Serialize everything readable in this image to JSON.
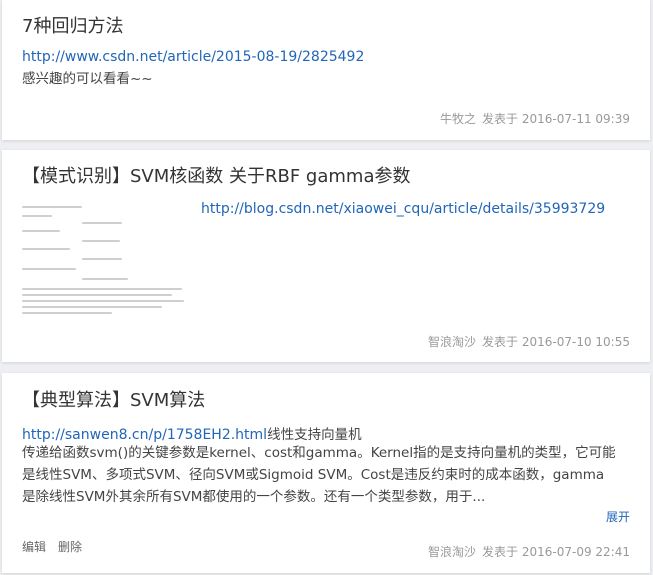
{
  "posts": [
    {
      "title": "7种回归方法",
      "link": "http://www.csdn.net/article/2015-08-19/2825492",
      "desc": "感兴趣的可以看看~~",
      "author": "牛牧之",
      "published": "发表于 2016-07-11 09:39"
    },
    {
      "title": "【模式识别】SVM核函数 关于RBF gamma参数",
      "link": "http://blog.csdn.net/xiaowei_cqu/article/details/35993729",
      "author": "智浪淘沙",
      "published": "发表于 2016-07-10 10:55"
    },
    {
      "title": "【典型算法】SVM算法",
      "link": "http://sanwen8.cn/p/1758EH2.html",
      "link_suffix": "线性支持向量机",
      "excerpt_1": "传递给函数svm()的关键参数是kernel、cost和gamma。Kernel指的是支持向量机的类型，它可能",
      "excerpt_2": "是线性SVM、多项式SVM、径向SVM或Sigmoid SVM。Cost是违反约束时的成本函数，gamma",
      "excerpt_3": "是除线性SVM外其余所有SVM都使用的一个参数。还有一个类型参数，用于...",
      "expand": "展开",
      "edit": "编辑",
      "delete": "删除",
      "author": "智浪淘沙",
      "published": "发表于 2016-07-09 22:41"
    }
  ]
}
